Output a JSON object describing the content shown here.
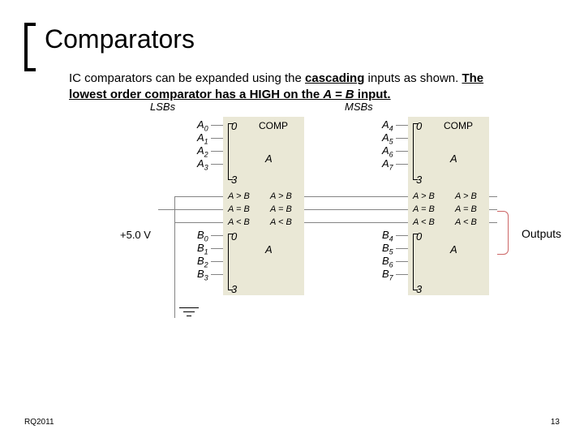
{
  "title": "Comparators",
  "desc_prefix": "IC comparators can be expanded using the ",
  "desc_cascading": "cascading",
  "desc_mid1": " inputs as shown. ",
  "desc_lowest": "The lowest order comparator has a HIGH on the ",
  "desc_aeqb": "A = B",
  "desc_input": " input.",
  "lsbs": "LSBs",
  "msbs": "MSBs",
  "comp": "COMP",
  "A": "A",
  "zero": "0",
  "three": "3",
  "agtb": "A > B",
  "aeqb_s": "A = B",
  "altb": "A < B",
  "A0": "A",
  "A0s": "0",
  "A1": "A",
  "A1s": "1",
  "A2": "A",
  "A2s": "2",
  "A3": "A",
  "A3s": "3",
  "A4": "A",
  "A4s": "4",
  "A5": "A",
  "A5s": "5",
  "A6": "A",
  "A6s": "6",
  "A7": "A",
  "A7s": "7",
  "B0": "B",
  "B0s": "0",
  "B1": "B",
  "B1s": "1",
  "B2": "B",
  "B2s": "2",
  "B3": "B",
  "B3s": "3",
  "B4": "B",
  "B4s": "4",
  "B5": "B",
  "B5s": "5",
  "B6": "B",
  "B6s": "6",
  "B7": "B",
  "B7s": "7",
  "volt": "+5.0 V",
  "outputs": "Outputs",
  "footer_left": "RQ2011",
  "footer_right": "13"
}
